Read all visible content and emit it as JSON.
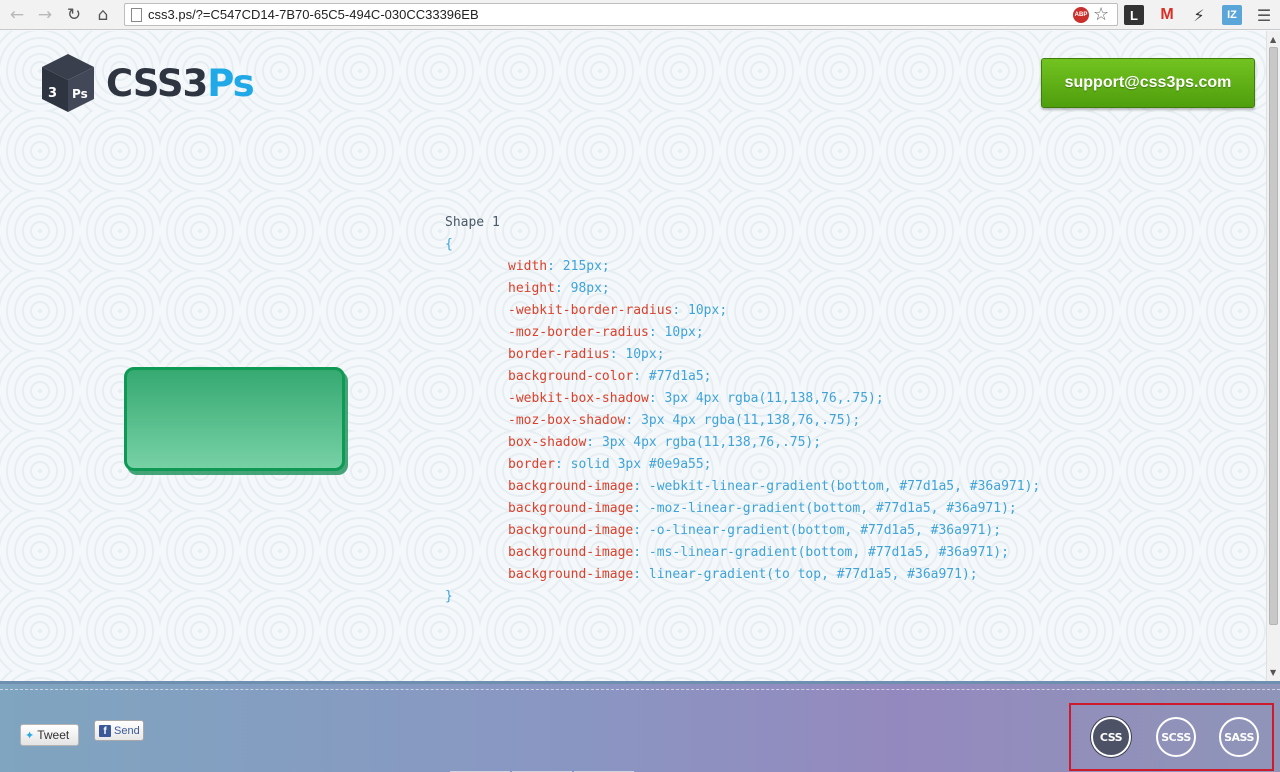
{
  "browser": {
    "url": "css3.ps/?=C547CD14-7B70-65C5-494C-030CC33396EB",
    "abp_label": "ABP",
    "ext_l": "L",
    "ext_m": "M",
    "ext_iz": "IZ"
  },
  "header": {
    "logo_part1": "CSS3",
    "logo_part2": "Ps",
    "support_label": "support@css3ps.com"
  },
  "code": {
    "title": "Shape 1",
    "open_brace": "{",
    "close_brace": "}",
    "lines": [
      {
        "prop": "width",
        "val": "215px;"
      },
      {
        "prop": "height",
        "val": "98px;"
      },
      {
        "prop": "-webkit-border-radius",
        "val": "10px;"
      },
      {
        "prop": "-moz-border-radius",
        "val": "10px;"
      },
      {
        "prop": "border-radius",
        "val": "10px;"
      },
      {
        "prop": "background-color",
        "val": "#77d1a5;"
      },
      {
        "prop": "-webkit-box-shadow",
        "val": "3px 4px rgba(11,138,76,.75);"
      },
      {
        "prop": "-moz-box-shadow",
        "val": "3px 4px rgba(11,138,76,.75);"
      },
      {
        "prop": "box-shadow",
        "val": "3px 4px rgba(11,138,76,.75);"
      },
      {
        "prop": "border",
        "val": "solid 3px #0e9a55;"
      },
      {
        "prop": "background-image",
        "val": "-webkit-linear-gradient(bottom, #77d1a5, #36a971);"
      },
      {
        "prop": "background-image",
        "val": "-moz-linear-gradient(bottom, #77d1a5, #36a971);"
      },
      {
        "prop": "background-image",
        "val": "-o-linear-gradient(bottom, #77d1a5, #36a971);"
      },
      {
        "prop": "background-image",
        "val": "-ms-linear-gradient(bottom, #77d1a5, #36a971);"
      },
      {
        "prop": "background-image",
        "val": "linear-gradient(to top, #77d1a5, #36a971);"
      }
    ]
  },
  "footer": {
    "tweet_label": "Tweet",
    "fb_icon": "f",
    "send_label": "Send",
    "formats": [
      "CSS",
      "SCSS",
      "SASS"
    ],
    "active_format": "CSS"
  },
  "colors": {
    "support_button": "#5fae16",
    "logo_dark": "#2f3441",
    "logo_blue": "#21a8e6",
    "shape_fill": "#77d1a5",
    "shape_border": "#0e9a55",
    "highlight_border": "#cc1b2c"
  },
  "icons": {
    "back": "arrow-left-icon",
    "forward": "arrow-right-icon",
    "reload": "reload-icon",
    "home": "home-icon",
    "bookmark": "star-icon",
    "menu": "hamburger-menu-icon"
  }
}
